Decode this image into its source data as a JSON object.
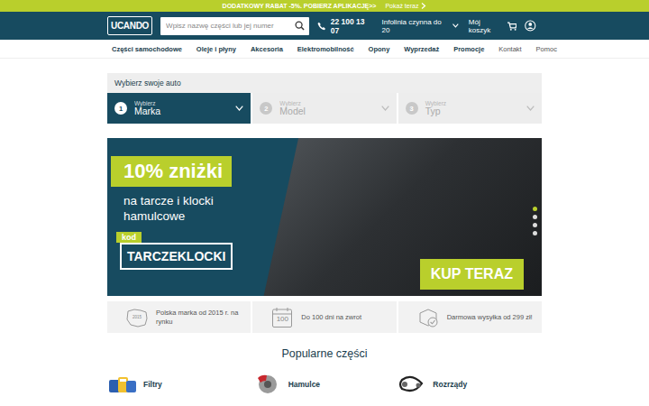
{
  "promo_bar": {
    "text": "DODATKOWY RABAT -5%. POBIERZ APLIKACJĘ>>",
    "link": "Pokaż teraz"
  },
  "header": {
    "logo": "UCANDO",
    "search": {
      "placeholder": "Wpisz nazwę części lub jej numer"
    },
    "phone": "22 100 13 07",
    "hotline": "Infolinia czynna do 20",
    "cart": "Mój koszyk"
  },
  "nav": [
    {
      "label": "Części samochodowe",
      "emphasized": true
    },
    {
      "label": "Oleje i płyny",
      "emphasized": true
    },
    {
      "label": "Akcesoria",
      "emphasized": true
    },
    {
      "label": "Elektromobilność",
      "emphasized": true
    },
    {
      "label": "Opony",
      "emphasized": true
    },
    {
      "label": "Wyprzedaż",
      "emphasized": true
    },
    {
      "label": "Promocje",
      "emphasized": true
    },
    {
      "label": "Kontakt",
      "emphasized": false
    },
    {
      "label": "Pomoc",
      "emphasized": false
    }
  ],
  "car_selector": {
    "title": "Wybierz swoje auto",
    "steps": [
      {
        "number": "1",
        "hint": "Wybierz",
        "label": "Marka",
        "selected": true
      },
      {
        "number": "2",
        "hint": "Wybierz",
        "label": "Model",
        "selected": false
      },
      {
        "number": "3",
        "hint": "Wybierz",
        "label": "Typ",
        "selected": false
      }
    ]
  },
  "banner": {
    "headline": "10% zniżki",
    "subtitle": "na tarcze i klocki hamulcowe",
    "code_label": "kod",
    "code": "TARCZEKLOCKI",
    "button": "KUP TERAZ",
    "slides": [
      {
        "selected": true
      },
      {
        "selected": false
      },
      {
        "selected": false
      },
      {
        "selected": false
      }
    ]
  },
  "features": [
    {
      "kind": "map",
      "badge": "2015",
      "text": "Polska marka od 2015 r. na rynku"
    },
    {
      "kind": "calendar",
      "badge": "100",
      "text": "Do 100 dni na zwrot"
    },
    {
      "kind": "delivery",
      "text": "Darmowa wysyłka od 299 zł!"
    }
  ],
  "popular": {
    "title": "Popularne części",
    "categories": [
      {
        "kind": "filters",
        "label": "Filtry"
      },
      {
        "kind": "brakes",
        "label": "Hamulce"
      },
      {
        "kind": "timing",
        "label": "Rozrządy"
      }
    ]
  }
}
